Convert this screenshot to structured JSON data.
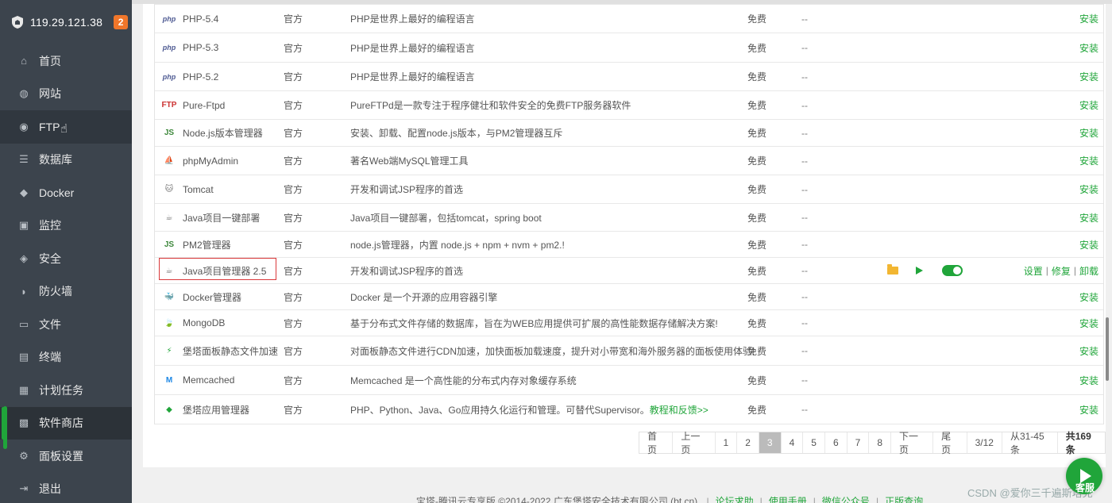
{
  "sidebar": {
    "server_ip": "119.29.121.38",
    "badge_count": "2",
    "items": [
      {
        "label": "首页",
        "icon": "home-icon",
        "glyph": "⌂"
      },
      {
        "label": "网站",
        "icon": "globe-icon",
        "glyph": "◍"
      },
      {
        "label": "FTP",
        "icon": "ftp-icon",
        "glyph": "◉"
      },
      {
        "label": "数据库",
        "icon": "database-icon",
        "glyph": "☰"
      },
      {
        "label": "Docker",
        "icon": "docker-icon",
        "glyph": "◆"
      },
      {
        "label": "监控",
        "icon": "monitor-icon",
        "glyph": "▣"
      },
      {
        "label": "安全",
        "icon": "security-icon",
        "glyph": "◈"
      },
      {
        "label": "防火墙",
        "icon": "firewall-icon",
        "glyph": "◗"
      },
      {
        "label": "文件",
        "icon": "folder-icon",
        "glyph": "▭"
      },
      {
        "label": "终端",
        "icon": "terminal-icon",
        "glyph": "▤"
      },
      {
        "label": "计划任务",
        "icon": "calendar-icon",
        "glyph": "▦"
      },
      {
        "label": "软件商店",
        "icon": "apps-icon",
        "glyph": "▩"
      },
      {
        "label": "面板设置",
        "icon": "settings-icon",
        "glyph": "⚙"
      },
      {
        "label": "退出",
        "icon": "logout-icon",
        "glyph": "⇥"
      }
    ]
  },
  "software_table": {
    "rows": [
      {
        "name": "PHP-5.4",
        "logo": "php",
        "developer": "官方",
        "desc": "PHP是世界上最好的编程语言",
        "price": "免费",
        "expire": "--",
        "action": "安装"
      },
      {
        "name": "PHP-5.3",
        "logo": "php",
        "developer": "官方",
        "desc": "PHP是世界上最好的编程语言",
        "price": "免费",
        "expire": "--",
        "action": "安装"
      },
      {
        "name": "PHP-5.2",
        "logo": "php",
        "developer": "官方",
        "desc": "PHP是世界上最好的编程语言",
        "price": "免费",
        "expire": "--",
        "action": "安装"
      },
      {
        "name": "Pure-Ftpd",
        "logo": "FTP",
        "developer": "官方",
        "desc": "PureFTPd是一款专注于程序健壮和软件安全的免费FTP服务器软件",
        "price": "免费",
        "expire": "--",
        "action": "安装"
      },
      {
        "name": "Node.js版本管理器",
        "logo": "JS",
        "developer": "官方",
        "desc": "安装、卸载、配置node.js版本，与PM2管理器互斥",
        "price": "免费",
        "expire": "--",
        "action": "安装"
      },
      {
        "name": "phpMyAdmin",
        "logo": "⛵",
        "developer": "官方",
        "desc": "著名Web端MySQL管理工具",
        "price": "免费",
        "expire": "--",
        "action": "安装"
      },
      {
        "name": "Tomcat",
        "logo": "🐱",
        "developer": "官方",
        "desc": "开发和调试JSP程序的首选",
        "price": "免费",
        "expire": "--",
        "action": "安装"
      },
      {
        "name": "Java项目一键部署",
        "logo": "☕",
        "developer": "官方",
        "desc": "Java项目一键部署，包括tomcat，spring boot",
        "price": "免费",
        "expire": "--",
        "action": "安装"
      },
      {
        "name": "PM2管理器",
        "logo": "JS",
        "developer": "官方",
        "desc": "node.js管理器，内置 node.js + npm + nvm + pm2.!",
        "price": "免费",
        "expire": "--",
        "action": "安装"
      },
      {
        "name": "Java项目管理器 2.5",
        "logo": "☕",
        "developer": "官方",
        "desc": "开发和调试JSP程序的首选",
        "price": "免费",
        "expire": "--",
        "installed": true,
        "actions": [
          "设置",
          "修复",
          "卸载"
        ]
      },
      {
        "name": "Docker管理器",
        "logo": "🐳",
        "developer": "官方",
        "desc": "Docker 是一个开源的应用容器引擎",
        "price": "免费",
        "expire": "--",
        "action": "安装"
      },
      {
        "name": "MongoDB",
        "logo": "🍃",
        "developer": "官方",
        "desc": "基于分布式文件存储的数据库，旨在为WEB应用提供可扩展的高性能数据存储解决方案!",
        "price": "免费",
        "expire": "--",
        "action": "安装"
      },
      {
        "name": "堡塔面板静态文件加速",
        "logo": "⚡",
        "developer": "官方",
        "desc": "对面板静态文件进行CDN加速，加快面板加载速度，提升对小带宽和海外服务器的面板使用体验!",
        "price": "免费",
        "expire": "--",
        "action": "安装"
      },
      {
        "name": "Memcached",
        "logo": "M",
        "developer": "官方",
        "desc": "Memcached 是一个高性能的分布式内存对象缓存系统",
        "price": "免费",
        "expire": "--",
        "action": "安装"
      },
      {
        "name": "堡塔应用管理器",
        "logo": "◆",
        "developer": "官方",
        "desc": "PHP、Python、Java、Go应用持久化运行和管理。可替代Supervisor。",
        "desc_link": "教程和反馈>>",
        "price": "免费",
        "expire": "--",
        "action": "安装"
      }
    ]
  },
  "pagination": {
    "first": "首页",
    "prev": "上一页",
    "pages": [
      "1",
      "2",
      "3",
      "4",
      "5",
      "6",
      "7",
      "8"
    ],
    "current": "3",
    "next": "下一页",
    "last": "尾页",
    "page_of": "3/12",
    "range": "从31-45条",
    "total": "共169条"
  },
  "footer": {
    "copyright": "宝塔-腾讯云专享版 ©2014-2022 广东堡塔安全技术有限公司 (bt.cn)",
    "links": [
      "论坛求助",
      "使用手册",
      "微信公众号",
      "正版查询"
    ]
  },
  "watermark": "CSDN @爱你三千遍斯塔克",
  "service_button": "客服",
  "colors": {
    "accent": "#20a53a",
    "sidebar_bg": "#3c444d",
    "badge": "#f0762a",
    "highlight_border": "#d9383a"
  }
}
